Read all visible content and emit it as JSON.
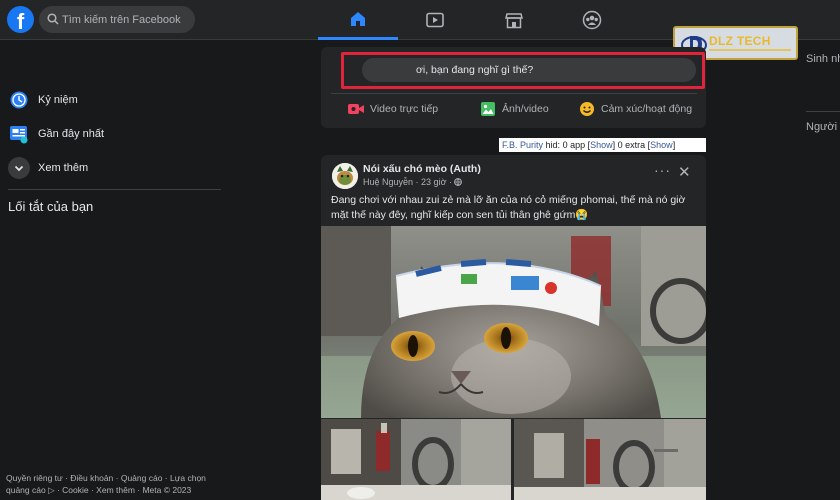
{
  "topbar": {
    "logo": "f",
    "search_placeholder": "Tìm kiếm trên Facebook",
    "tabs": [
      {
        "name": "home",
        "icon": "home-icon",
        "active": true
      },
      {
        "name": "watch",
        "icon": "video-icon",
        "active": false
      },
      {
        "name": "marketplace",
        "icon": "store-icon",
        "active": false
      },
      {
        "name": "groups",
        "icon": "groups-icon",
        "active": false
      }
    ]
  },
  "watermark": {
    "text": "DLZ TECH"
  },
  "sidebar": {
    "items": [
      {
        "label": "Kỷ niệm",
        "icon": "clock-icon"
      },
      {
        "label": "Gần đây nhất",
        "icon": "feed-icon"
      },
      {
        "label": "Xem thêm",
        "icon": "chevron-down-icon"
      }
    ],
    "shortcuts_title": "Lối tắt của bạn",
    "footer_line1": "Quyền riêng tư · Điều khoản · Quảng cáo · Lựa chọn",
    "footer_line2": "quảng cáo ▷ · Cookie · Xem thêm · Meta © 2023"
  },
  "composer": {
    "placeholder": "ơi, bạn đang nghĩ gì thế?",
    "actions": [
      {
        "label": "Video trực tiếp",
        "icon": "live-video-icon",
        "color": "#f3425f"
      },
      {
        "label": "Ảnh/video",
        "icon": "photo-icon",
        "color": "#45bd62"
      },
      {
        "label": "Cảm xúc/hoạt động",
        "icon": "feeling-icon",
        "color": "#f7b928"
      }
    ]
  },
  "fbpurity": {
    "brand": "F.B. Purity",
    "hid_label": "hid:",
    "apps": "0 app",
    "show1": "Show",
    "extra": "0 extra",
    "show2": "Show"
  },
  "post": {
    "group": "Nói xấu chó mèo (Auth)",
    "author": "Huệ Nguyễn",
    "time": "23 giờ",
    "text": "Đang chơi với nhau zui zẻ mà lỡ ăn của nó cỏ miếng phomai, thế mà nó giờ mặt thế này đêy, nghĩ kiếp con sen tủi thân ghê gứm😭"
  },
  "right": {
    "birthdays": "Sinh nh",
    "contacts": "Người"
  },
  "colors": {
    "background": "#18191a",
    "card": "#242526",
    "accent": "#2d88ff",
    "highlight": "#e0243b"
  }
}
